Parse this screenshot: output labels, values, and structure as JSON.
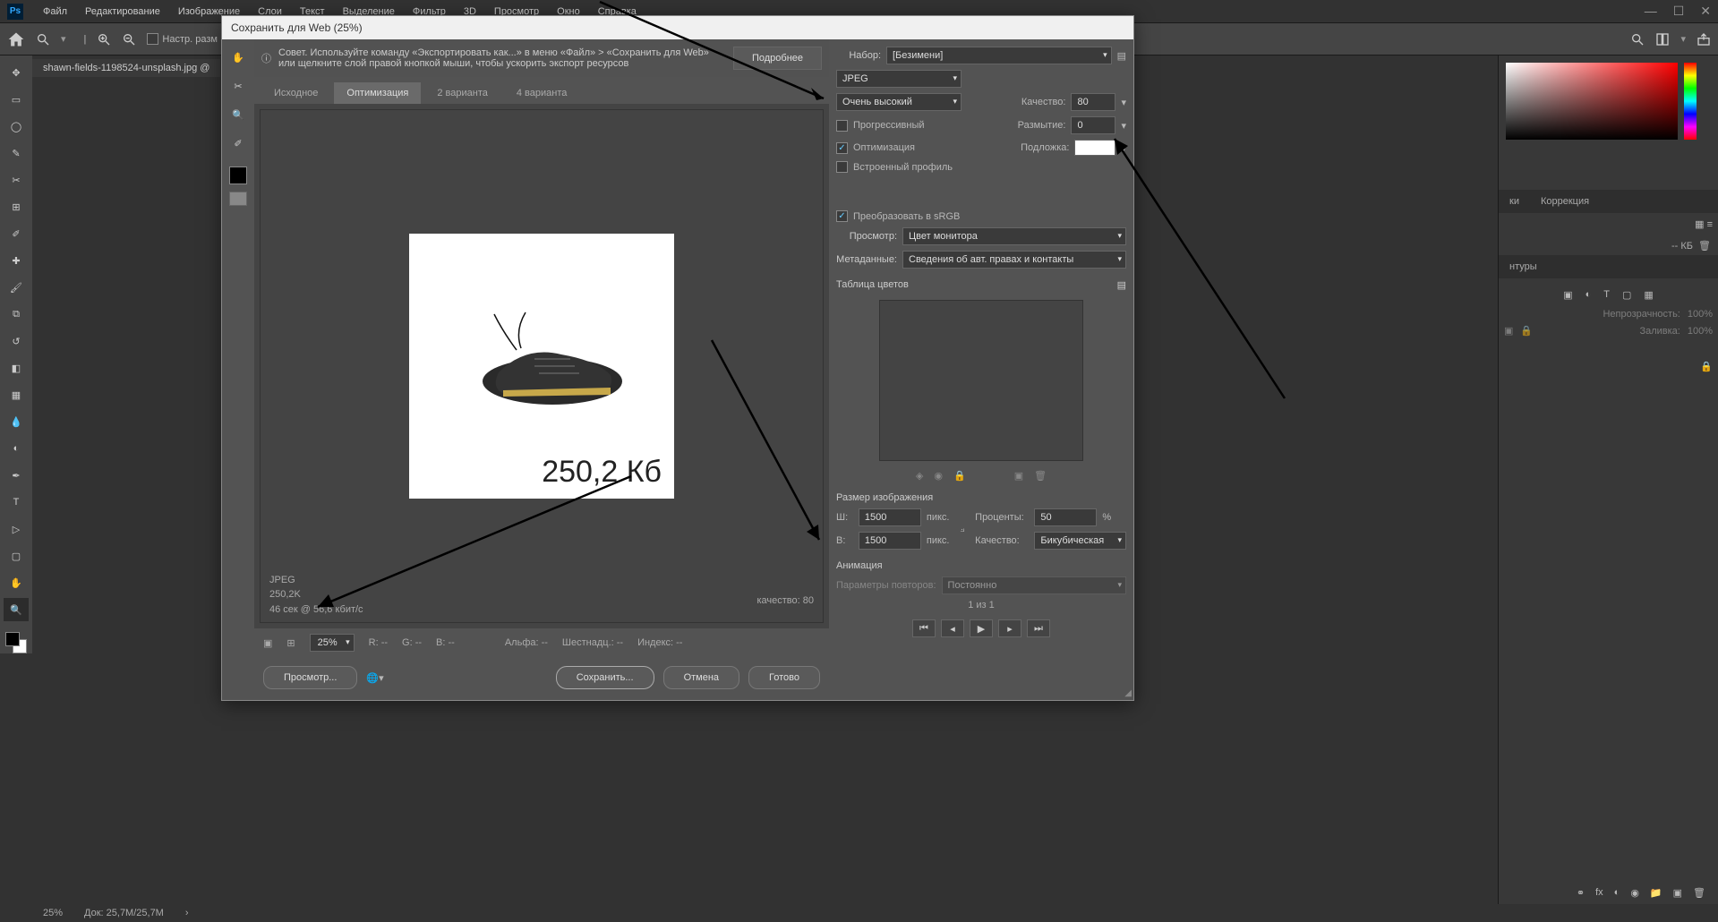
{
  "menubar": {
    "items": [
      "Файл",
      "Редактирование",
      "Изображение",
      "Слои",
      "Текст",
      "Выделение",
      "Фильтр",
      "3D",
      "Просмотр",
      "Окно",
      "Справка"
    ]
  },
  "optionsbar": {
    "checkbox_label": "Настр. разм"
  },
  "doctab": "shawn-fields-1198524-unsplash.jpg @",
  "dialog": {
    "title": "Сохранить для Web (25%)",
    "tip_text": "Совет. Используйте команду «Экспортировать как...» в меню «Файл» > «Сохранить для Web» или щелкните слой правой кнопкой мыши, чтобы ускорить экспорт ресурсов",
    "tip_button": "Подробнее",
    "tabs": [
      "Исходное",
      "Оптимизация",
      "2 варианта",
      "4 варианта"
    ],
    "active_tab": 1,
    "preview": {
      "format": "JPEG",
      "size": "250,2K",
      "timing": "46 сек @ 56,6 кбит/с",
      "quality_label": "качество: 80",
      "overlay_text": "250,2 Кб"
    },
    "bottom1": {
      "zoom": "25%",
      "r": "R: --",
      "g": "G: --",
      "b": "B: --",
      "alpha": "Альфа: --",
      "hex": "Шестнадц.: --",
      "index": "Индекс: --"
    },
    "bottom2": {
      "preview": "Просмотр...",
      "save": "Сохранить...",
      "cancel": "Отмена",
      "done": "Готово"
    },
    "settings": {
      "preset_label": "Набор:",
      "preset_value": "[Безимени]",
      "format": "JPEG",
      "quality_preset": "Очень высокий",
      "quality_label": "Качество:",
      "quality_value": "80",
      "blur_label": "Размытие:",
      "blur_value": "0",
      "progressive": "Прогрессивный",
      "optimized": "Оптимизация",
      "embed_profile": "Встроенный профиль",
      "matte_label": "Подложка:",
      "convert_srgb": "Преобразовать в sRGB",
      "preview_label": "Просмотр:",
      "preview_value": "Цвет монитора",
      "metadata_label": "Метаданные:",
      "metadata_value": "Сведения об авт. правах и контакты",
      "colortable_title": "Таблица цветов",
      "imagesize_title": "Размер изображения",
      "w_label": "Ш:",
      "w_value": "1500",
      "h_label": "В:",
      "h_value": "1500",
      "px": "пикс.",
      "percent_label": "Проценты:",
      "percent_value": "50",
      "percent_sign": "%",
      "quality2_label": "Качество:",
      "quality2_value": "Бикубическая",
      "animation_title": "Анимация",
      "loop_label": "Параметры повторов:",
      "loop_value": "Постоянно",
      "frame_count": "1 из 1"
    }
  },
  "right_panels": {
    "tabs1": [
      "ки",
      "Коррекция"
    ],
    "tabs2": [
      "нтуры"
    ],
    "opacity_label": "Непрозрачность:",
    "opacity_value": "100%",
    "fill_label": "Заливка:",
    "fill_value": "100%",
    "kb": "-- КБ"
  },
  "statusbar": {
    "zoom": "25%",
    "doc": "Док: 25,7M/25,7M"
  }
}
